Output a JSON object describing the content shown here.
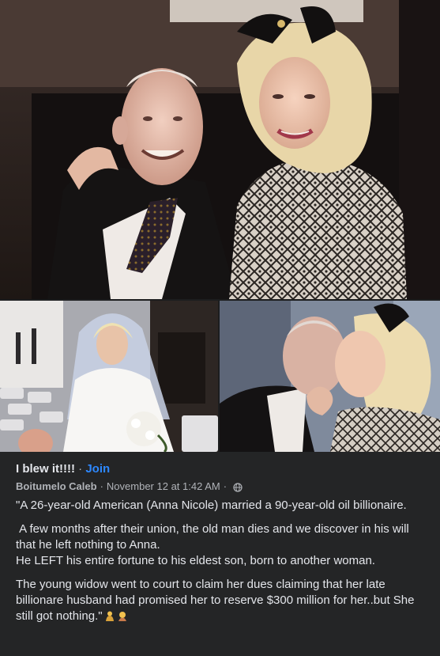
{
  "photos": [
    {
      "name": "couple-portrait-photo"
    },
    {
      "name": "bride-wedding-photo"
    },
    {
      "name": "couple-kiss-photo"
    }
  ],
  "post": {
    "group_name": "I blew it!!!!",
    "separator": "·",
    "join_label": "Join",
    "author": "Boitumelo Caleb",
    "date": "November 12 at 1:42 AM",
    "audience_icon": "globe-icon",
    "paragraph_1": "\"A 26-year-old American (Anna Nicole) married a 90-year-old oil billionaire.",
    "paragraph_2a": "A few months after their union, the old man dies and we discover in his will that he left nothing to Anna.",
    "paragraph_2b": "He LEFT his entire fortune to his eldest son, born to another woman.",
    "paragraph_3": "The young widow went to court to claim her dues claiming that her late billionare husband had promised her to reserve $300 million for her..but She still got nothing.\"",
    "trailing_emojis": [
      "person-bowing-emoji",
      "person-gesturing-emoji"
    ]
  },
  "colors": {
    "background": "#242526",
    "text_primary": "#e4e6eb",
    "text_secondary": "#b0b3b8",
    "link": "#2d88ff"
  }
}
